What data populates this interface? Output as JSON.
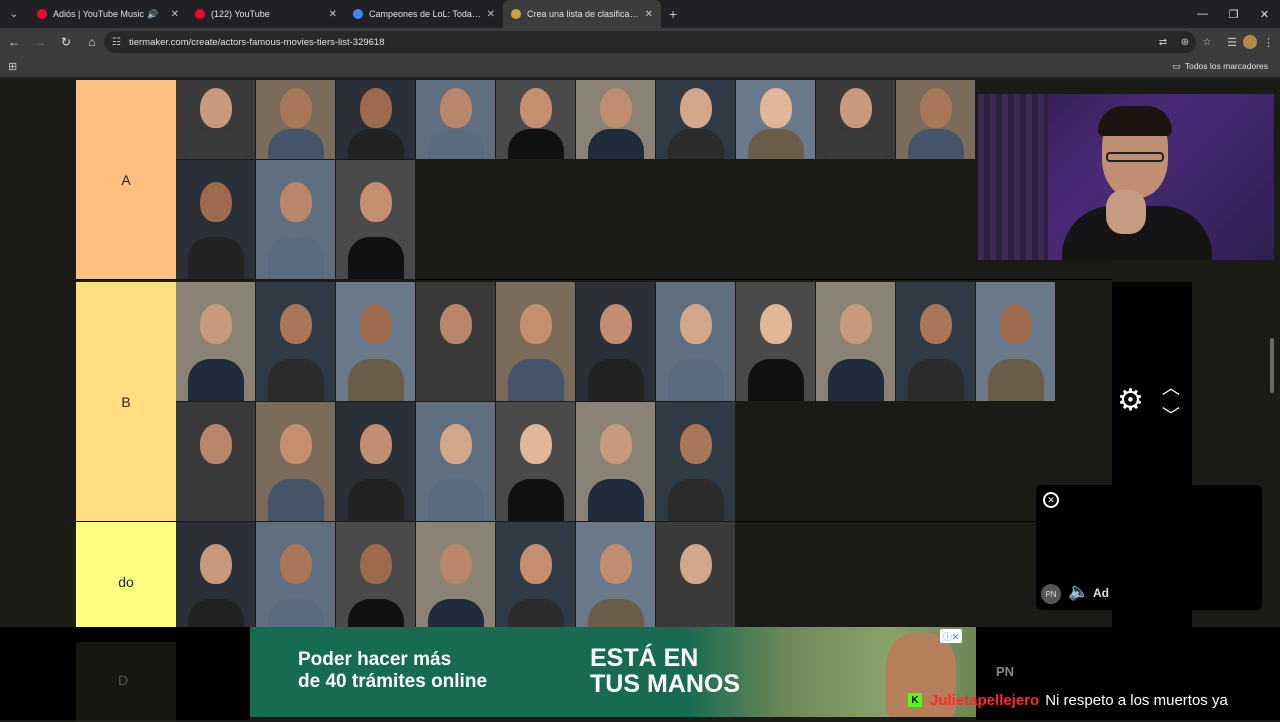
{
  "browser": {
    "tabs": [
      {
        "title": "Adiós | YouTube Music",
        "favicon_color": "#ff0033",
        "sound": true,
        "active": false
      },
      {
        "title": "(122) YouTube",
        "favicon_color": "#ff0033",
        "sound": false,
        "active": false
      },
      {
        "title": "Campeones de LoL: Todas las c",
        "favicon_color": "#4285f4",
        "sound": false,
        "active": false
      },
      {
        "title": "Crea una lista de clasificación d",
        "favicon_color": "#cfa23a",
        "sound": false,
        "active": true
      }
    ],
    "url": "tiermaker.com/create/actors-famous-movies-tiers-list-329618",
    "bookmarks_all_label": "Todos los marcadores",
    "icons": {
      "tab_list": "chevron-down-icon",
      "back": "arrow-left-icon",
      "forward": "arrow-right-icon",
      "reload": "reload-icon",
      "home": "home-icon",
      "site_info": "tune-icon",
      "translate": "translate-icon",
      "zoom": "zoom-icon",
      "bookmark": "star-icon",
      "reading": "reading-list-icon",
      "menu": "kebab-menu-icon",
      "apps": "apps-grid-icon",
      "folder": "folder-icon"
    }
  },
  "tiers": [
    {
      "label": "A",
      "color": "#ffbf7f",
      "count": 13
    },
    {
      "label": "B",
      "color": "#ffdf7f",
      "count": 18
    },
    {
      "label": "do",
      "color": "#ffff7f",
      "count": 7
    },
    {
      "label": "D",
      "color": "#bfff7f",
      "count": 0
    }
  ],
  "ad": {
    "badge": "PN",
    "label": "Ad"
  },
  "banner": {
    "left_line1": "Poder hacer más",
    "left_line2": "de 40 trámites online",
    "mid_line1": "ESTÁ EN",
    "mid_line2": "TUS MANOS"
  },
  "overlay": {
    "pn_text": "PN",
    "chat_user": "Julietapellejero",
    "chat_message": "Ni respeto a los muertos ya"
  }
}
